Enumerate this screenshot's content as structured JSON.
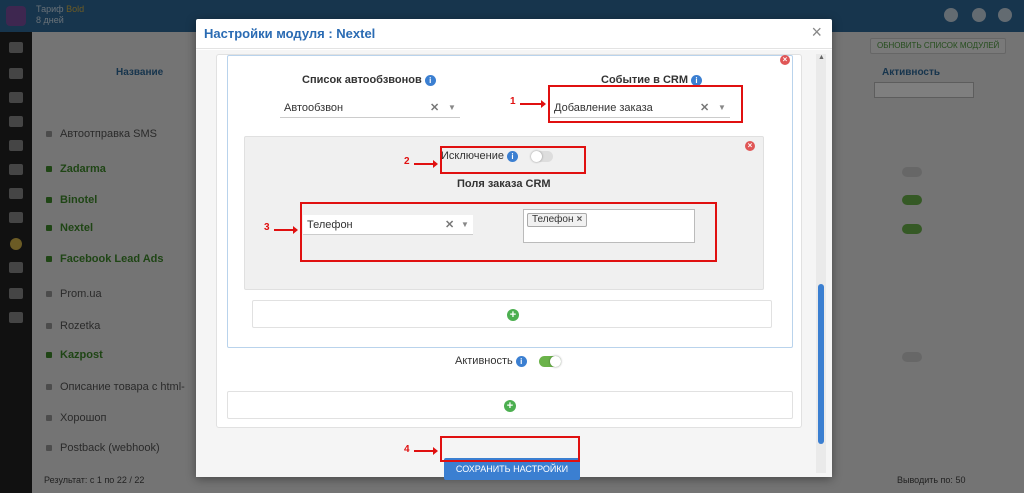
{
  "app": {
    "tariff_label": "Тариф",
    "tariff_value": "Bold",
    "tariff_days": "8 дней",
    "refresh_button": "ОБНОВИТЬ СПИСОК МОДУЛЕЙ",
    "columns": {
      "name": "Название",
      "active": "Активность"
    },
    "modules": [
      {
        "name": "Автоотправка SMS",
        "enabled": false
      },
      {
        "name": "Zadarma",
        "enabled": true
      },
      {
        "name": "Binotel",
        "enabled": true
      },
      {
        "name": "Nextel",
        "enabled": true
      },
      {
        "name": "Facebook Lead Ads",
        "enabled": true
      },
      {
        "name": "Prom.ua",
        "enabled": false
      },
      {
        "name": "Rozetka",
        "enabled": false
      },
      {
        "name": "Kazpost",
        "enabled": true
      },
      {
        "name": "Описание товара с html-",
        "enabled": false
      },
      {
        "name": "Хорошоп",
        "enabled": false
      },
      {
        "name": "Postback (webhook)",
        "enabled": false
      }
    ],
    "result_text": "Результат: с 1 по 22 / 22",
    "per_page_label": "Выводить по:",
    "per_page_value": "50"
  },
  "modal": {
    "title": "Настройки модуля : Nextel",
    "close": "×",
    "autodial_list_label": "Список автообзвонов",
    "autodial_list_value": "Автообзвон",
    "crm_event_label": "Событие в CRM",
    "crm_event_value": "Добавление заказа",
    "exception_label": "Исключение",
    "exception_enabled": false,
    "crm_order_fields_label": "Поля заказа CRM",
    "field_select_value": "Телефон",
    "field_tags": [
      "Телефон"
    ],
    "activity_label": "Активность",
    "activity_enabled": true,
    "save_button": "СОХРАНИТЬ НАСТРОЙКИ"
  },
  "annotations": [
    "1",
    "2",
    "3",
    "4"
  ],
  "colors": {
    "accent": "#3b7fd1",
    "title": "#2a6bb3",
    "annotation": "#e01010",
    "toggle_on": "#6bb34a",
    "add": "#4caf50",
    "remove": "#e05656"
  }
}
